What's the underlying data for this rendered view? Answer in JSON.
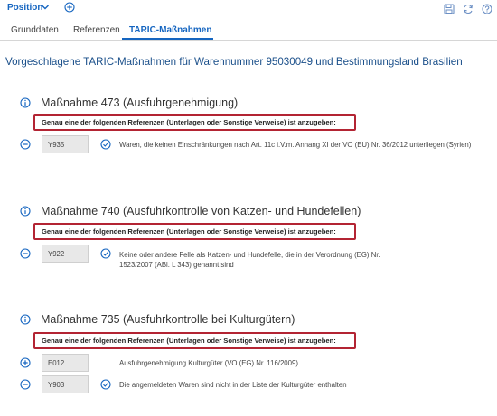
{
  "toolbar": {
    "position_label": "Position",
    "icons": [
      "chevron-down-icon",
      "plus-circle-icon",
      "save-icon",
      "refresh-icon",
      "help-icon"
    ]
  },
  "tabs": [
    {
      "label": "Grunddaten",
      "active": false
    },
    {
      "label": "Referenzen",
      "active": false
    },
    {
      "label": "TARIC-Maßnahmen",
      "active": true
    }
  ],
  "page": {
    "heading": "Vorgeschlagene TARIC-Maßnahmen für Warennummer 95030049 und Bestimmungsland Brasilien"
  },
  "measures": [
    {
      "title": "Maßnahme 473 (Ausfuhrgenehmigung)",
      "requirement": "Genau eine der folgenden Referenzen (Unterlagen oder Sonstige Verweise) ist anzugeben:",
      "references": [
        {
          "code": "Y935",
          "action": "remove",
          "checked": true,
          "text": "Waren, die keinen Einschränkungen nach Art. 11c i.V.m. Anhang XI der VO (EU) Nr. 36/2012 unterliegen (Syrien)"
        }
      ]
    },
    {
      "title": "Maßnahme 740 (Ausfuhrkontrolle von Katzen- und Hundefellen)",
      "requirement": "Genau eine der folgenden Referenzen (Unterlagen oder Sonstige Verweise) ist anzugeben:",
      "references": [
        {
          "code": "Y922",
          "action": "remove",
          "checked": true,
          "text": "Keine oder andere Felle als Katzen- und Hundefelle, die in der Verordnung (EG) Nr. 1523/2007 (ABl. L 343) genannt sind"
        }
      ]
    },
    {
      "title": "Maßnahme 735 (Ausfuhrkontrolle bei Kulturgütern)",
      "requirement": "Genau eine der folgenden Referenzen (Unterlagen oder Sonstige Verweise) ist anzugeben:",
      "references": [
        {
          "code": "E012",
          "action": "add",
          "checked": false,
          "text": "Ausfuhrgenehmigung Kulturgüter (VO (EG) Nr. 116/2009)"
        },
        {
          "code": "Y903",
          "action": "remove",
          "checked": true,
          "text": "Die angemeldeten Waren sind nicht in der Liste der Kulturgüter enthalten"
        }
      ]
    }
  ],
  "colors": {
    "accent": "#1565c0",
    "highlight": "#b32433",
    "heading": "#1a4f8a"
  }
}
